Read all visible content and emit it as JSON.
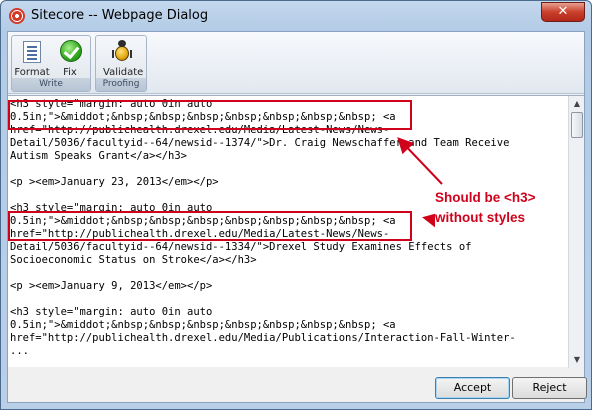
{
  "window": {
    "title": "Sitecore -- Webpage Dialog",
    "close_glyph": "✕"
  },
  "ribbon": {
    "groups": [
      {
        "label": "Write",
        "buttons": [
          {
            "label": "Format",
            "icon": "format-icon"
          },
          {
            "label": "Fix",
            "icon": "green-check-icon"
          }
        ]
      },
      {
        "label": "Proofing",
        "buttons": [
          {
            "label": "Validate",
            "icon": "bug-icon"
          }
        ]
      }
    ]
  },
  "editor": {
    "lines": [
      "<h3 style=\"margin: auto 0in auto",
      "0.5in;\">&middot;&nbsp;&nbsp;&nbsp;&nbsp;&nbsp;&nbsp;&nbsp; <a",
      "href=\"http://publichealth.drexel.edu/Media/Latest-News/News-",
      "Detail/5036/facultyid--64/newsid--1374/\">Dr. Craig Newschaffer and Team Receive",
      "Autism Speaks Grant</a></h3>",
      "",
      "<p ><em>January 23, 2013</em></p>",
      "",
      "<h3 style=\"margin: auto 0in auto",
      "0.5in;\">&middot;&nbsp;&nbsp;&nbsp;&nbsp;&nbsp;&nbsp;&nbsp; <a",
      "href=\"http://publichealth.drexel.edu/Media/Latest-News/News-",
      "Detail/5036/facultyid--64/newsid--1334/\">Drexel Study Examines Effects of",
      "Socioeconomic Status on Stroke</a></h3>",
      "",
      "<p ><em>January 9, 2013</em></p>",
      "",
      "<h3 style=\"margin: auto 0in auto",
      "0.5in;\">&middot;&nbsp;&nbsp;&nbsp;&nbsp;&nbsp;&nbsp;&nbsp; <a",
      "href=\"http://publichealth.drexel.edu/Media/Publications/Interaction-Fall-Winter-",
      "..."
    ]
  },
  "annotation": {
    "line1": "Should be <h3>",
    "line2": "without styles",
    "color": "#d0021b"
  },
  "footer": {
    "accept_label": "Accept",
    "reject_label": "Reject"
  }
}
